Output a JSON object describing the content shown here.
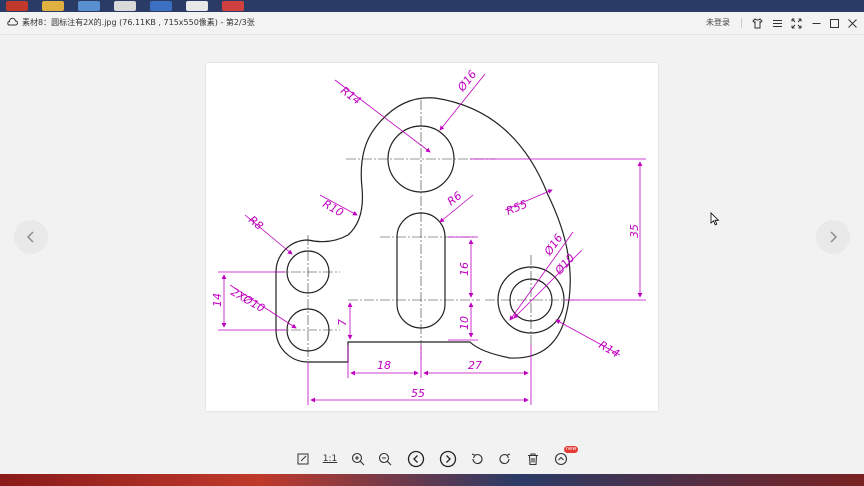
{
  "window": {
    "title": "素材8：圆标注有2X的.jpg (76.11KB , 715x550像素) - 第2/3张",
    "login_label": "未登录"
  },
  "toolbar_icons": [
    "cloud-icon",
    "shirt-icon",
    "menu-icon",
    "fullscreen-icon",
    "minimize-icon",
    "maximize-icon",
    "close-icon"
  ],
  "bottom_toolbar": {
    "actual_size_label": "1:1",
    "badge": "new"
  },
  "drawing": {
    "labels": {
      "r14_top": "R14",
      "d16_top": "Ø16",
      "r10": "R10",
      "r6": "R6",
      "r55": "R55",
      "r8": "R8",
      "d16_right": "Ø16",
      "d10_right": "Ø10",
      "two_x_d10": "2XØ10",
      "r14_right": "R14",
      "dim_35": "35",
      "dim_16": "16",
      "dim_10": "10",
      "dim_14": "14",
      "dim_7": "7",
      "dim_18": "18",
      "dim_27": "27",
      "dim_55": "55"
    }
  },
  "colors": {
    "dimension": "#c000c0",
    "outline": "#222222",
    "centerline": "#333333"
  }
}
